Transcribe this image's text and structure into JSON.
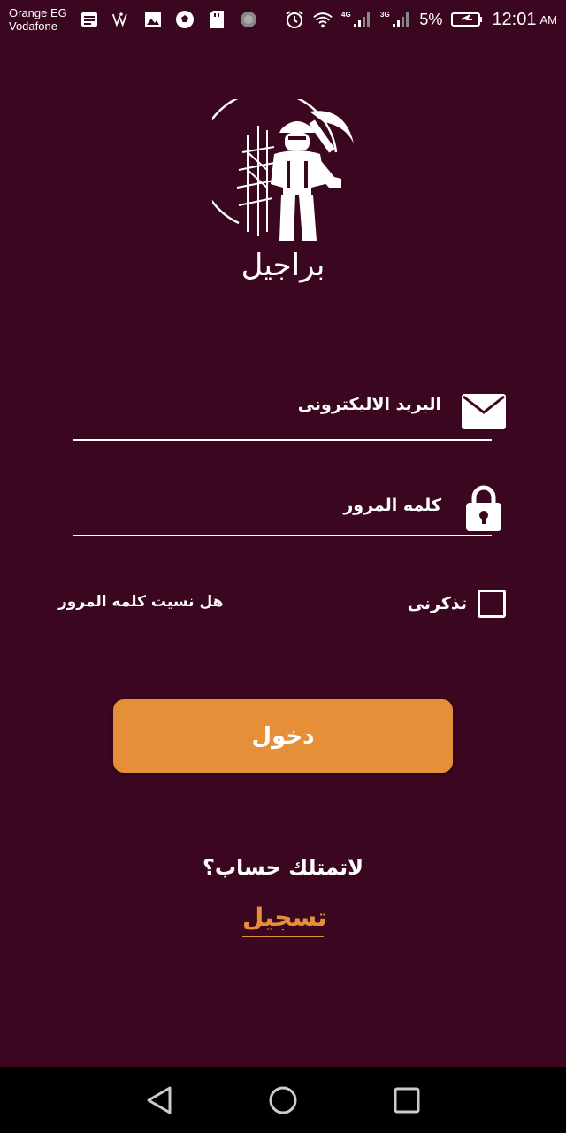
{
  "status_bar": {
    "carrier_1": "Orange EG",
    "carrier_2": "Vodafone",
    "network_1": "4G",
    "network_2": "3G",
    "battery": "5%",
    "time": "12:01",
    "ampm": "AM"
  },
  "app": {
    "brand_name": "براجيل"
  },
  "login": {
    "email_label": "البريد الاليكترونى",
    "password_label": "كلمه المرور",
    "remember_label": "تذكرنى",
    "forgot_label": "هل نسيت كلمه المرور",
    "submit_label": "دخول",
    "no_account_text": "لاتمتلك حساب؟",
    "register_label": "تسجيل"
  },
  "colors": {
    "background": "#3a0620",
    "accent": "#e58f38",
    "nav_bar": "#000000"
  },
  "icons": {
    "email": "mail-icon",
    "password": "lock-icon",
    "back": "back-triangle-icon",
    "home": "home-circle-icon",
    "recents": "recents-square-icon"
  }
}
